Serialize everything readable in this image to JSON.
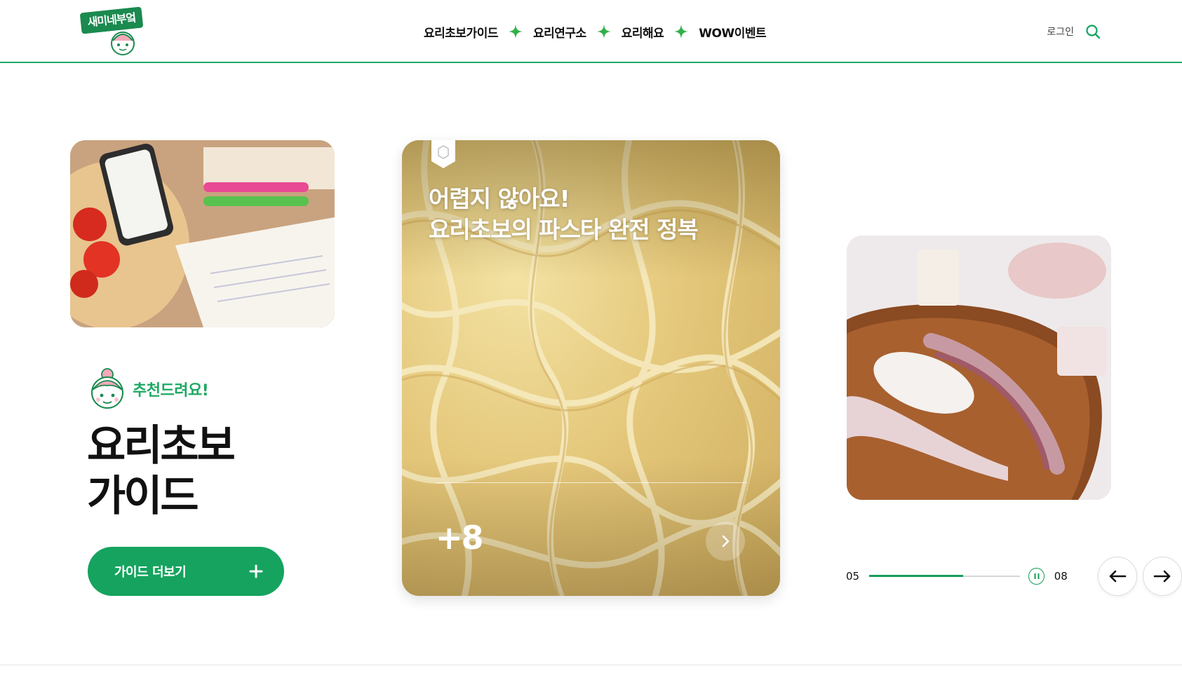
{
  "brand": {
    "logo_text": "새미네부엌"
  },
  "nav": {
    "items": [
      {
        "label": "요리초보가이드"
      },
      {
        "label": "요리연구소"
      },
      {
        "label": "요리해요"
      },
      {
        "label": "WOW이벤트"
      }
    ]
  },
  "header": {
    "login_label": "로그인"
  },
  "left": {
    "badge": "추천드려요!",
    "title_line1": "요리초보",
    "title_line2": "가이드",
    "button_label": "가이드 더보기"
  },
  "center_card": {
    "title_line1": "어렵지 않아요!",
    "title_line2": "요리초보의 파스타 완전 정복",
    "count": "+8"
  },
  "pager": {
    "current": "05",
    "total": "08",
    "progress": 0.62
  },
  "colors": {
    "brand_green": "#15a35f",
    "header_border": "#20a86a",
    "text_dark": "#111111"
  }
}
